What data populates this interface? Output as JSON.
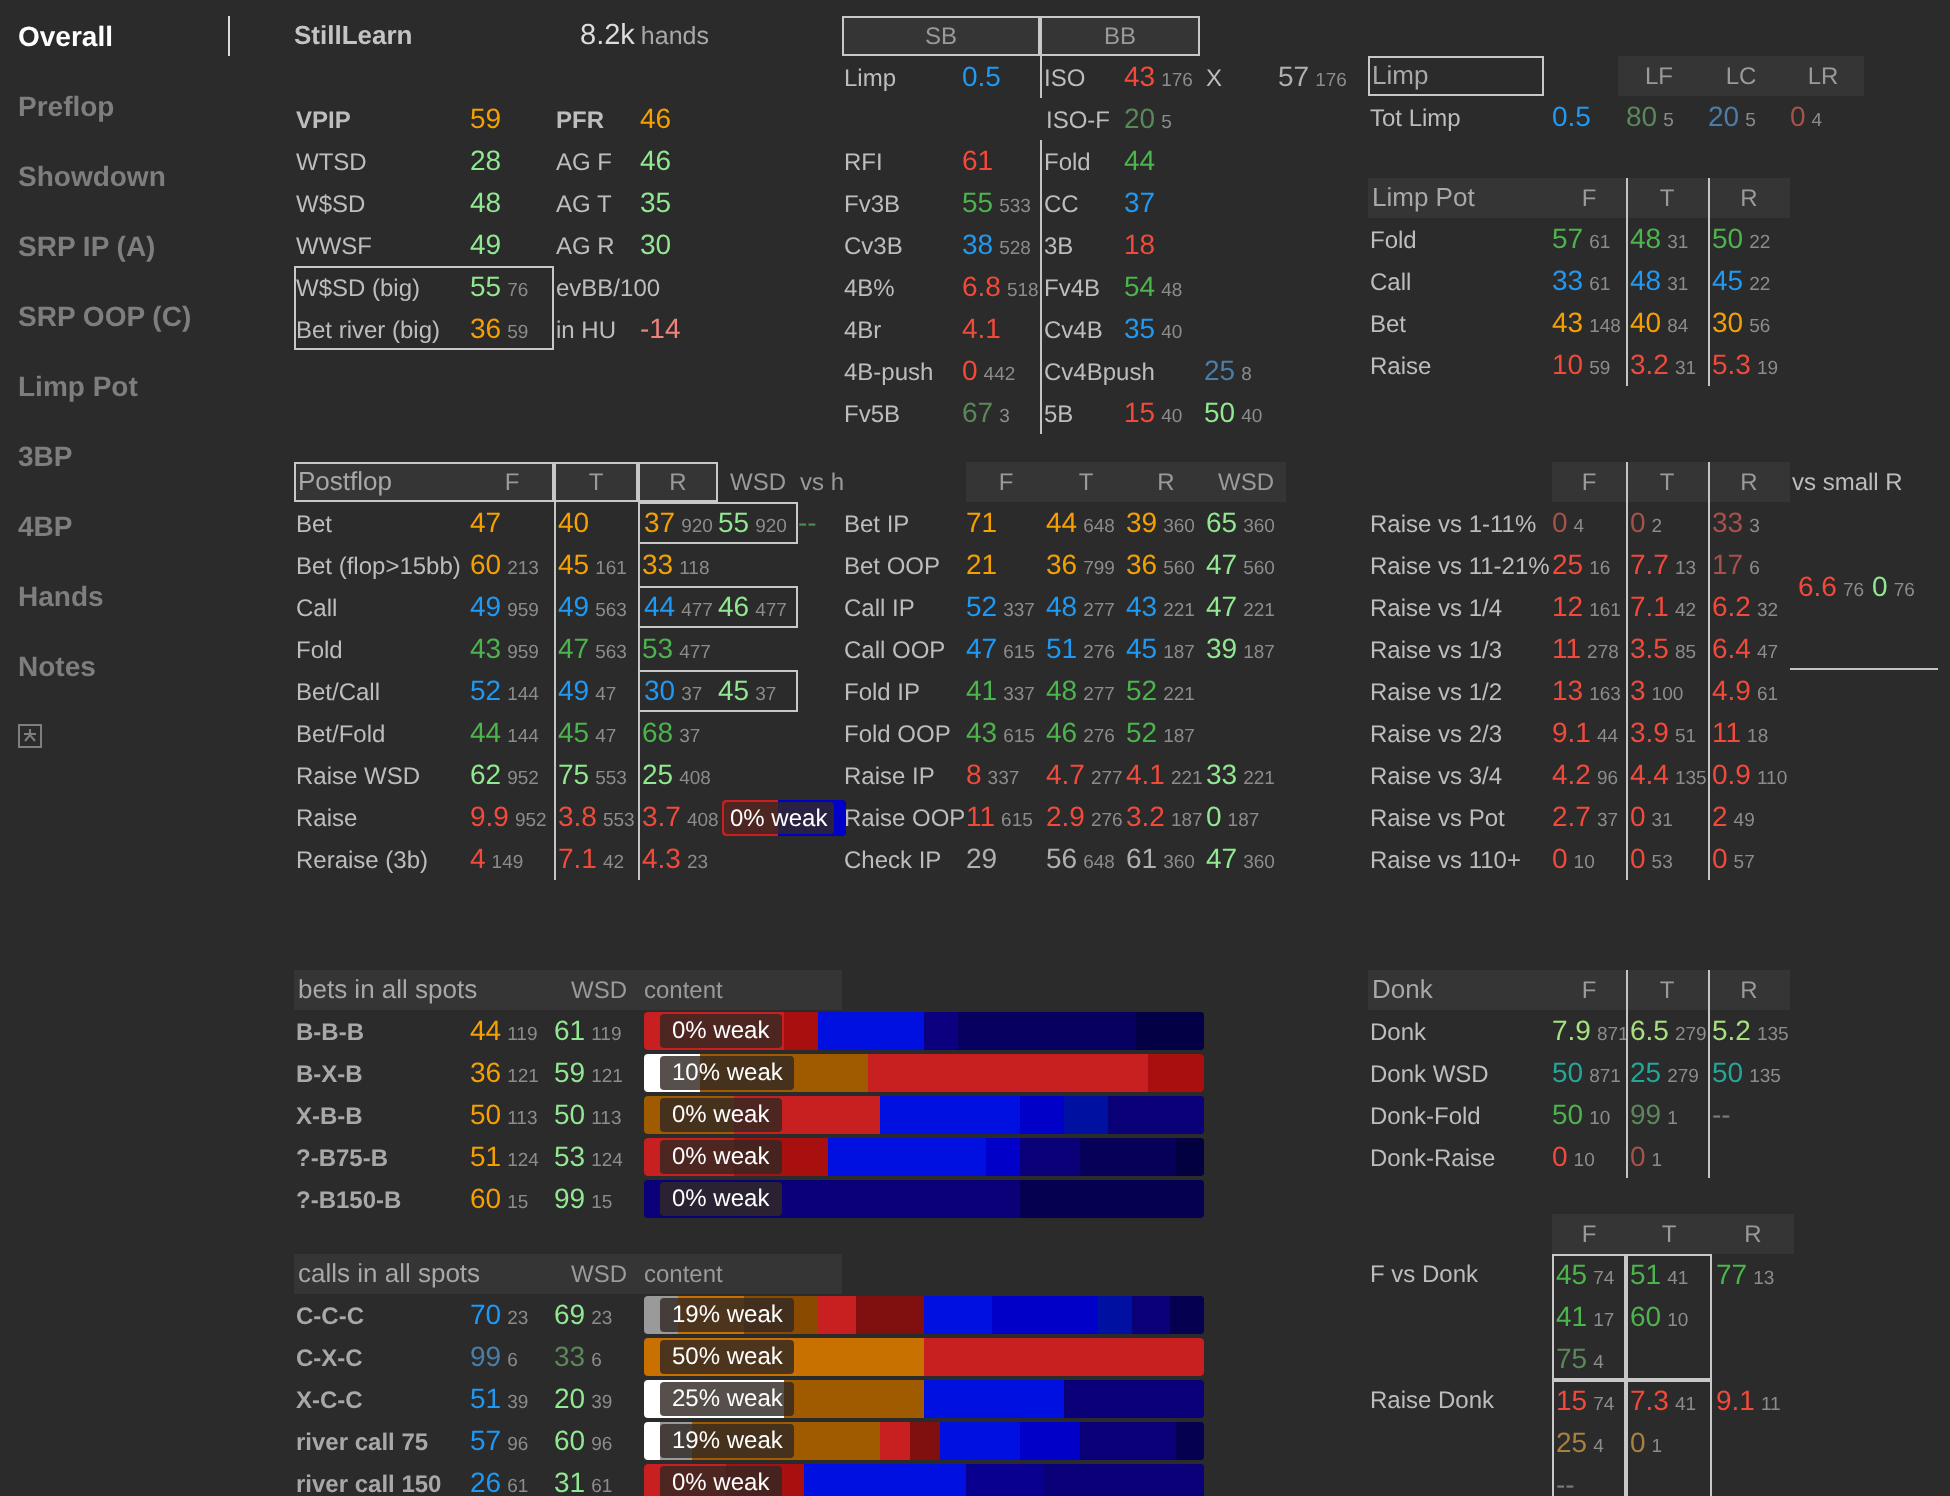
{
  "sidebar": {
    "items": [
      {
        "kind": "text",
        "label": "Overall",
        "selected": true
      },
      {
        "kind": "text",
        "label": "Preflop",
        "selected": false
      },
      {
        "kind": "text",
        "label": "Showdown",
        "selected": false
      },
      {
        "kind": "text",
        "label": "SRP IP (A)",
        "selected": false
      },
      {
        "kind": "text",
        "label": "SRP OOP (C)",
        "selected": false
      },
      {
        "kind": "text",
        "label": "Limp Pot",
        "selected": false
      },
      {
        "kind": "text",
        "label": "3BP",
        "selected": false
      },
      {
        "kind": "text",
        "label": "4BP",
        "selected": false
      },
      {
        "kind": "text",
        "label": "Hands",
        "selected": false
      },
      {
        "kind": "text",
        "label": "Notes",
        "selected": false
      },
      {
        "kind": "icon",
        "selected": false
      }
    ]
  },
  "player": {
    "name": "StillLearn",
    "hands": "8.2k",
    "hands_label": "hands"
  },
  "summary": {
    "rows": [
      {
        "emphasis": true,
        "boxed": false,
        "label": "VPIP",
        "stat": {
          "value": "59",
          "color": "#f5a000"
        },
        "label_2": "PFR",
        "stat_2": {
          "value": "46",
          "color": "#f5a000"
        }
      },
      {
        "emphasis": false,
        "boxed": false,
        "label": "WTSD",
        "stat": {
          "value": "28",
          "color": "#90e890"
        },
        "label_2": "AG F",
        "stat_2": {
          "value": "46",
          "color": "#90e890"
        }
      },
      {
        "emphasis": false,
        "boxed": false,
        "label": "W$SD",
        "stat": {
          "value": "48",
          "color": "#90e890"
        },
        "label_2": "AG T",
        "stat_2": {
          "value": "35",
          "color": "#90e890"
        }
      },
      {
        "emphasis": false,
        "boxed": false,
        "label": "WWSF",
        "stat": {
          "value": "49",
          "color": "#90e890"
        },
        "label_2": "AG R",
        "stat_2": {
          "value": "30",
          "color": "#90e890"
        }
      },
      {
        "emphasis": false,
        "boxed": true,
        "label": "W$SD (big)",
        "stat": {
          "value": "55",
          "count": "76",
          "color": "#90e890"
        },
        "label_2": "evBB/100"
      },
      {
        "emphasis": false,
        "boxed": true,
        "label": "Bet river (big)",
        "stat": {
          "value": "36",
          "count": "59",
          "color": "#f5a000"
        },
        "label_2": "in HU",
        "stat_2": {
          "value": "-14",
          "color": "#f0847a"
        }
      }
    ]
  },
  "postflop": {
    "title": "Postflop",
    "columns": [
      "F",
      "T",
      "R",
      "WSD",
      "vs h"
    ],
    "rows": [
      {
        "label": "Bet",
        "boxed": true,
        "cells": [
          {
            "value": "47",
            "color": "#f5a000"
          },
          {
            "value": "40",
            "color": "#f5a000"
          },
          {
            "value": "37",
            "count": "920",
            "color": "#f5a000"
          },
          {
            "value": "55",
            "count": "920",
            "color": "#90e890"
          },
          {
            "value": "--",
            "color": "#4f8a4f"
          }
        ]
      },
      {
        "label": "Bet (flop>15bb)",
        "boxed": false,
        "cells": [
          {
            "value": "60",
            "count": "213",
            "color": "#f5a000"
          },
          {
            "value": "45",
            "count": "161",
            "color": "#f5a000"
          },
          {
            "value": "33",
            "count": "118",
            "color": "#f5a000"
          },
          null,
          null
        ]
      },
      {
        "label": "Call",
        "boxed": true,
        "cells": [
          {
            "value": "49",
            "count": "959",
            "color": "#1e9af5"
          },
          {
            "value": "49",
            "count": "563",
            "color": "#1e9af5"
          },
          {
            "value": "44",
            "count": "477",
            "color": "#1e9af5"
          },
          {
            "value": "46",
            "count": "477",
            "color": "#90e890"
          },
          null
        ]
      },
      {
        "label": "Fold",
        "boxed": false,
        "cells": [
          {
            "value": "43",
            "count": "959",
            "color": "#4cb44c"
          },
          {
            "value": "47",
            "count": "563",
            "color": "#4cb44c"
          },
          {
            "value": "53",
            "count": "477",
            "color": "#4cb44c"
          },
          null,
          null
        ]
      },
      {
        "label": "Bet/Call",
        "boxed": true,
        "cells": [
          {
            "value": "52",
            "count": "144",
            "color": "#1e9af5"
          },
          {
            "value": "49",
            "count": "47",
            "color": "#1e9af5"
          },
          {
            "value": "30",
            "count": "37",
            "color": "#1e9af5"
          },
          {
            "value": "45",
            "count": "37",
            "color": "#90e890"
          },
          null
        ]
      },
      {
        "label": "Bet/Fold",
        "boxed": false,
        "cells": [
          {
            "value": "44",
            "count": "144",
            "color": "#4cb44c"
          },
          {
            "value": "45",
            "count": "47",
            "color": "#4cb44c"
          },
          {
            "value": "68",
            "count": "37",
            "color": "#4cb44c"
          },
          null,
          null
        ]
      },
      {
        "label": "Raise WSD",
        "boxed": false,
        "cells": [
          {
            "value": "62",
            "count": "952",
            "color": "#90e890"
          },
          {
            "value": "75",
            "count": "553",
            "color": "#90e890"
          },
          {
            "value": "25",
            "count": "408",
            "color": "#90e890"
          },
          null,
          null
        ]
      },
      {
        "label": "Raise",
        "boxed": false,
        "cells": [
          {
            "value": "9.9",
            "count": "952",
            "color": "#f24a3a"
          },
          {
            "value": "3.8",
            "count": "553",
            "color": "#f24a3a"
          },
          {
            "value": "3.7",
            "count": "408",
            "color": "#f24a3a"
          },
          null,
          null
        ],
        "bar": {
          "label": "0% weak",
          "segments": [
            {
              "color": "#c82020"
            },
            {
              "color": "#0000c8"
            }
          ]
        }
      },
      {
        "label": "Reraise (3b)",
        "boxed": false,
        "cells": [
          {
            "value": "4",
            "count": "149",
            "color": "#f24a3a"
          },
          {
            "value": "7.1",
            "count": "42",
            "color": "#f24a3a"
          },
          {
            "value": "4.3",
            "count": "23",
            "color": "#f24a3a"
          },
          null,
          null
        ]
      }
    ]
  },
  "preflop": {
    "columns": [
      "SB",
      "BB"
    ],
    "rows": [
      {
        "sb_label": "Limp",
        "sb_stat": {
          "value": "0.5",
          "color": "#1e9af5"
        },
        "bb_label": "ISO",
        "bb_stat": {
          "value": "43",
          "count": "176",
          "color": "#f24a3a"
        },
        "extra": [
          {
            "kind": "label",
            "text": "X"
          },
          {
            "kind": "stat",
            "value": "57",
            "count": "176",
            "color": "#b0b0b0"
          }
        ]
      },
      {
        "bb_label": "ISO-F",
        "bb_stat": {
          "value": "20",
          "count": "5",
          "color": "#5a885a"
        }
      },
      {
        "sb_label": "RFI",
        "sb_stat": {
          "value": "61",
          "color": "#f24a3a"
        },
        "bb_label": "Fold",
        "bb_stat": {
          "value": "44",
          "color": "#4cb44c"
        }
      },
      {
        "sb_label": "Fv3B",
        "sb_stat": {
          "value": "55",
          "count": "533",
          "color": "#4cb44c"
        },
        "bb_label": "CC",
        "bb_stat": {
          "value": "37",
          "color": "#1e9af5"
        }
      },
      {
        "sb_label": "Cv3B",
        "sb_stat": {
          "value": "38",
          "count": "528",
          "color": "#1e9af5"
        },
        "bb_label": "3B",
        "bb_stat": {
          "value": "18",
          "color": "#f24a3a"
        }
      },
      {
        "sb_label": "4B%",
        "sb_stat": {
          "value": "6.8",
          "count": "518",
          "color": "#f24a3a"
        },
        "bb_label": "Fv4B",
        "bb_stat": {
          "value": "54",
          "count": "48",
          "color": "#4cb44c"
        }
      },
      {
        "sb_label": "4Br",
        "sb_stat": {
          "value": "4.1",
          "color": "#f24a3a"
        },
        "bb_label": "Cv4B",
        "bb_stat": {
          "value": "35",
          "count": "40",
          "color": "#1e9af5"
        }
      },
      {
        "sb_label": "4B-push",
        "sb_stat": {
          "value": "0",
          "count": "442",
          "color": "#f24a3a"
        },
        "bb_label": "Cv4Bpush",
        "extra": [
          {
            "kind": "stat",
            "value": "25",
            "count": "8",
            "color": "#4a7ea8"
          }
        ]
      },
      {
        "sb_label": "Fv5B",
        "sb_stat": {
          "value": "67",
          "count": "3",
          "color": "#5a885a"
        },
        "bb_label": "5B",
        "bb_stat": {
          "value": "15",
          "count": "40",
          "color": "#f24a3a"
        },
        "extra": [
          {
            "kind": "stat",
            "value": "50",
            "count": "40",
            "color": "#90e890"
          }
        ]
      }
    ]
  },
  "position_stats": {
    "columns": [
      "F",
      "T",
      "R",
      "WSD"
    ],
    "rows": [
      {
        "label": "Bet IP",
        "cells": [
          {
            "value": "71",
            "color": "#f5a000"
          },
          {
            "value": "44",
            "count": "648",
            "color": "#f5a000"
          },
          {
            "value": "39",
            "count": "360",
            "color": "#f5a000"
          },
          {
            "value": "65",
            "count": "360",
            "color": "#90e890"
          }
        ]
      },
      {
        "label": "Bet OOP",
        "cells": [
          {
            "value": "21",
            "color": "#f5a000"
          },
          {
            "value": "36",
            "count": "799",
            "color": "#f5a000"
          },
          {
            "value": "36",
            "count": "560",
            "color": "#f5a000"
          },
          {
            "value": "47",
            "count": "560",
            "color": "#90e890"
          }
        ]
      },
      {
        "label": "Call IP",
        "cells": [
          {
            "value": "52",
            "count": "337",
            "color": "#1e9af5"
          },
          {
            "value": "48",
            "count": "277",
            "color": "#1e9af5"
          },
          {
            "value": "43",
            "count": "221",
            "color": "#1e9af5"
          },
          {
            "value": "47",
            "count": "221",
            "color": "#90e890"
          }
        ]
      },
      {
        "label": "Call OOP",
        "cells": [
          {
            "value": "47",
            "count": "615",
            "color": "#1e9af5"
          },
          {
            "value": "51",
            "count": "276",
            "color": "#1e9af5"
          },
          {
            "value": "45",
            "count": "187",
            "color": "#1e9af5"
          },
          {
            "value": "39",
            "count": "187",
            "color": "#90e890"
          }
        ]
      },
      {
        "label": "Fold IP",
        "cells": [
          {
            "value": "41",
            "count": "337",
            "color": "#4cb44c"
          },
          {
            "value": "48",
            "count": "277",
            "color": "#4cb44c"
          },
          {
            "value": "52",
            "count": "221",
            "color": "#4cb44c"
          },
          null
        ]
      },
      {
        "label": "Fold OOP",
        "cells": [
          {
            "value": "43",
            "count": "615",
            "color": "#4cb44c"
          },
          {
            "value": "46",
            "count": "276",
            "color": "#4cb44c"
          },
          {
            "value": "52",
            "count": "187",
            "color": "#4cb44c"
          },
          null
        ]
      },
      {
        "label": "Raise IP",
        "cells": [
          {
            "value": "8",
            "count": "337",
            "color": "#f24a3a"
          },
          {
            "value": "4.7",
            "count": "277",
            "color": "#f24a3a"
          },
          {
            "value": "4.1",
            "count": "221",
            "color": "#f24a3a"
          },
          {
            "value": "33",
            "count": "221",
            "color": "#90e890"
          }
        ]
      },
      {
        "label": "Raise OOP",
        "cells": [
          {
            "value": "11",
            "count": "615",
            "color": "#f24a3a"
          },
          {
            "value": "2.9",
            "count": "276",
            "color": "#f24a3a"
          },
          {
            "value": "3.2",
            "count": "187",
            "color": "#f24a3a"
          },
          {
            "value": "0",
            "count": "187",
            "color": "#90e890"
          }
        ]
      },
      {
        "label": "Check IP",
        "cells": [
          {
            "value": "29",
            "color": "#b0b0b0"
          },
          {
            "value": "56",
            "count": "648",
            "color": "#b0b0b0"
          },
          {
            "value": "61",
            "count": "360",
            "color": "#b0b0b0"
          },
          {
            "value": "47",
            "count": "360",
            "color": "#90e890"
          }
        ]
      }
    ]
  },
  "limp": {
    "title": "Limp",
    "columns": [
      "LF",
      "LC",
      "LR"
    ],
    "rows": [
      {
        "label": "Tot Limp",
        "total": {
          "value": "0.5",
          "color": "#1e9af5"
        },
        "cells": [
          {
            "value": "80",
            "count": "5",
            "color": "#5a885a"
          },
          {
            "value": "20",
            "count": "5",
            "color": "#4a7ea8"
          },
          {
            "value": "0",
            "count": "4",
            "color": "#a8504a"
          }
        ]
      }
    ]
  },
  "limp_pot": {
    "title": "Limp Pot",
    "columns": [
      "F",
      "T",
      "R"
    ],
    "rows": [
      {
        "label": "Fold",
        "cells": [
          {
            "value": "57",
            "count": "61",
            "color": "#4cb44c"
          },
          {
            "value": "48",
            "count": "31",
            "color": "#4cb44c"
          },
          {
            "value": "50",
            "count": "22",
            "color": "#4cb44c"
          }
        ]
      },
      {
        "label": "Call",
        "cells": [
          {
            "value": "33",
            "count": "61",
            "color": "#1e9af5"
          },
          {
            "value": "48",
            "count": "31",
            "color": "#1e9af5"
          },
          {
            "value": "45",
            "count": "22",
            "color": "#1e9af5"
          }
        ]
      },
      {
        "label": "Bet",
        "cells": [
          {
            "value": "43",
            "count": "148",
            "color": "#f5a000"
          },
          {
            "value": "40",
            "count": "84",
            "color": "#f5a000"
          },
          {
            "value": "30",
            "count": "56",
            "color": "#f5a000"
          }
        ]
      },
      {
        "label": "Raise",
        "cells": [
          {
            "value": "10",
            "count": "59",
            "color": "#f24a3a"
          },
          {
            "value": "3.2",
            "count": "31",
            "color": "#f24a3a"
          },
          {
            "value": "5.3",
            "count": "19",
            "color": "#f24a3a"
          }
        ]
      }
    ]
  },
  "raise_vs": {
    "columns": [
      "F",
      "T",
      "R"
    ],
    "side_label": "vs small R",
    "side_cells": [
      {
        "value": "6.6",
        "count": "76",
        "color": "#f24a3a"
      },
      {
        "value": "0",
        "count": "76",
        "color": "#90e890"
      }
    ],
    "rows": [
      {
        "label": "Raise vs 1-11%",
        "cells": [
          {
            "value": "0",
            "count": "4",
            "color": "#a8504a"
          },
          {
            "value": "0",
            "count": "2",
            "color": "#a8504a"
          },
          {
            "value": "33",
            "count": "3",
            "color": "#a8504a"
          }
        ]
      },
      {
        "label": "Raise vs 11-21%",
        "cells": [
          {
            "value": "25",
            "count": "16",
            "color": "#f24a3a"
          },
          {
            "value": "7.7",
            "count": "13",
            "color": "#f24a3a"
          },
          {
            "value": "17",
            "count": "6",
            "color": "#a8504a"
          }
        ]
      },
      {
        "label": "Raise vs 1/4",
        "cells": [
          {
            "value": "12",
            "count": "161",
            "color": "#f24a3a"
          },
          {
            "value": "7.1",
            "count": "42",
            "color": "#f24a3a"
          },
          {
            "value": "6.2",
            "count": "32",
            "color": "#f24a3a"
          }
        ]
      },
      {
        "label": "Raise vs 1/3",
        "cells": [
          {
            "value": "11",
            "count": "278",
            "color": "#f24a3a"
          },
          {
            "value": "3.5",
            "count": "85",
            "color": "#f24a3a"
          },
          {
            "value": "6.4",
            "count": "47",
            "color": "#f24a3a"
          }
        ]
      },
      {
        "label": "Raise vs 1/2",
        "cells": [
          {
            "value": "13",
            "count": "163",
            "color": "#f24a3a"
          },
          {
            "value": "3",
            "count": "100",
            "color": "#f24a3a"
          },
          {
            "value": "4.9",
            "count": "61",
            "color": "#f24a3a"
          }
        ]
      },
      {
        "label": "Raise vs 2/3",
        "cells": [
          {
            "value": "9.1",
            "count": "44",
            "color": "#f24a3a"
          },
          {
            "value": "3.9",
            "count": "51",
            "color": "#f24a3a"
          },
          {
            "value": "11",
            "count": "18",
            "color": "#f24a3a"
          }
        ]
      },
      {
        "label": "Raise vs 3/4",
        "cells": [
          {
            "value": "4.2",
            "count": "96",
            "color": "#f24a3a"
          },
          {
            "value": "4.4",
            "count": "135",
            "color": "#f24a3a"
          },
          {
            "value": "0.9",
            "count": "110",
            "color": "#f24a3a"
          }
        ]
      },
      {
        "label": "Raise vs Pot",
        "cells": [
          {
            "value": "2.7",
            "count": "37",
            "color": "#f24a3a"
          },
          {
            "value": "0",
            "count": "31",
            "color": "#f24a3a"
          },
          {
            "value": "2",
            "count": "49",
            "color": "#f24a3a"
          }
        ]
      },
      {
        "label": "Raise vs 110+",
        "cells": [
          {
            "value": "0",
            "count": "10",
            "color": "#f24a3a"
          },
          {
            "value": "0",
            "count": "53",
            "color": "#f24a3a"
          },
          {
            "value": "0",
            "count": "57",
            "color": "#f24a3a"
          }
        ]
      }
    ]
  },
  "bets": {
    "title": "bets in all spots",
    "columns": [
      "WSD",
      "content"
    ],
    "rows": [
      {
        "label": "B-B-B",
        "stat": {
          "value": "44",
          "count": "119",
          "color": "#f5a000"
        },
        "wsd": {
          "value": "61",
          "count": "119",
          "color": "#90e890"
        },
        "bar": {
          "label": "0% weak",
          "segments": [
            {
              "color": "#c82020"
            },
            {
              "color": "#a81010"
            },
            {
              "color": "#0010e0"
            },
            {
              "color": "#0a0080"
            },
            {
              "color": "#060060"
            },
            {
              "color": "#030045"
            }
          ]
        }
      },
      {
        "label": "B-X-B",
        "stat": {
          "value": "36",
          "count": "121",
          "color": "#f5a000"
        },
        "wsd": {
          "value": "59",
          "count": "121",
          "color": "#90e890"
        },
        "bar": {
          "label": "10% weak",
          "segments": [
            {
              "color": "#ffffff"
            },
            {
              "color": "#a05a00"
            },
            {
              "color": "#c82020"
            },
            {
              "color": "#a81010"
            }
          ]
        }
      },
      {
        "label": "X-B-B",
        "stat": {
          "value": "50",
          "count": "113",
          "color": "#f5a000"
        },
        "wsd": {
          "value": "50",
          "count": "113",
          "color": "#90e890"
        },
        "bar": {
          "label": "0% weak",
          "segments": [
            {
              "color": "#a05a00"
            },
            {
              "color": "#c82020"
            },
            {
              "color": "#0010e0"
            },
            {
              "color": "#0000c8"
            },
            {
              "color": "#0010a0"
            },
            {
              "color": "#0a0078"
            }
          ]
        }
      },
      {
        "label": "?-B75-B",
        "stat": {
          "value": "51",
          "count": "124",
          "color": "#f5a000"
        },
        "wsd": {
          "value": "53",
          "count": "124",
          "color": "#90e890"
        },
        "bar": {
          "label": "0% weak",
          "segments": [
            {
              "color": "#c82020"
            },
            {
              "color": "#a81010"
            },
            {
              "color": "#0010e0"
            },
            {
              "color": "#0000c8"
            },
            {
              "color": "#0a0078"
            },
            {
              "color": "#060058"
            },
            {
              "color": "#030040"
            }
          ]
        }
      },
      {
        "label": "?-B150-B",
        "stat": {
          "value": "60",
          "count": "15",
          "color": "#f5a000"
        },
        "wsd": {
          "value": "99",
          "count": "15",
          "color": "#90e890"
        },
        "bar": {
          "label": "0% weak",
          "segments": [
            {
              "color": "#0a0078"
            },
            {
              "color": "#050050"
            }
          ]
        }
      }
    ]
  },
  "calls": {
    "title": "calls in all spots",
    "columns": [
      "WSD",
      "content"
    ],
    "rows": [
      {
        "label": "C-C-C",
        "stat": {
          "value": "70",
          "count": "23",
          "color": "#1e9af5"
        },
        "wsd": {
          "value": "69",
          "count": "23",
          "color": "#90e890"
        },
        "bar": {
          "label": "19% weak",
          "segments": [
            {
              "color": "#9a9a9a"
            },
            {
              "color": "#c87000"
            },
            {
              "color": "#8a4a00"
            },
            {
              "color": "#c82020"
            },
            {
              "color": "#801010"
            },
            {
              "color": "#0010e0"
            },
            {
              "color": "#0000c8"
            },
            {
              "color": "#0010a0"
            },
            {
              "color": "#0a0078"
            },
            {
              "color": "#050050"
            }
          ]
        }
      },
      {
        "label": "C-X-C",
        "stat": {
          "value": "99",
          "count": "6",
          "color": "#4a7ea8"
        },
        "wsd": {
          "value": "33",
          "count": "6",
          "color": "#5a885a"
        },
        "bar": {
          "label": "50% weak",
          "segments": [
            {
              "color": "#c87000"
            },
            {
              "color": "#c82020"
            }
          ]
        }
      },
      {
        "label": "X-C-C",
        "stat": {
          "value": "51",
          "count": "39",
          "color": "#1e9af5"
        },
        "wsd": {
          "value": "20",
          "count": "39",
          "color": "#90e890"
        },
        "bar": {
          "label": "25% weak",
          "segments": [
            {
              "color": "#ffffff"
            },
            {
              "color": "#a05a00"
            },
            {
              "color": "#0010e0"
            },
            {
              "color": "#0a0078"
            }
          ]
        }
      },
      {
        "label": "river call 75",
        "stat": {
          "value": "57",
          "count": "96",
          "color": "#1e9af5"
        },
        "wsd": {
          "value": "60",
          "count": "96",
          "color": "#90e890"
        },
        "bar": {
          "label": "19% weak",
          "segments": [
            {
              "color": "#ffffff"
            },
            {
              "color": "#9a9a9a"
            },
            {
              "color": "#a05a00"
            },
            {
              "color": "#c82020"
            },
            {
              "color": "#801010"
            },
            {
              "color": "#0010e0"
            },
            {
              "color": "#0000c8"
            },
            {
              "color": "#0a0078"
            },
            {
              "color": "#050050"
            }
          ]
        }
      },
      {
        "label": "river call 150",
        "stat": {
          "value": "26",
          "count": "61",
          "color": "#1e9af5"
        },
        "wsd": {
          "value": "31",
          "count": "61",
          "color": "#90e890"
        },
        "bar": {
          "label": "0% weak",
          "segments": [
            {
              "color": "#c82020"
            },
            {
              "color": "#a81010"
            },
            {
              "color": "#0010e0"
            },
            {
              "color": "#0a0090"
            },
            {
              "color": "#0a0078"
            }
          ]
        }
      }
    ]
  },
  "donk": {
    "title": "Donk",
    "columns": [
      "F",
      "T",
      "R"
    ],
    "rows": [
      {
        "label": "Donk",
        "cells": [
          {
            "value": "7.9",
            "count": "871",
            "color": "#a8e080"
          },
          {
            "value": "6.5",
            "count": "279",
            "color": "#a8e080"
          },
          {
            "value": "5.2",
            "count": "135",
            "color": "#a8e080"
          }
        ]
      },
      {
        "label": "Donk WSD",
        "cells": [
          {
            "value": "50",
            "count": "871",
            "color": "#22a89a"
          },
          {
            "value": "25",
            "count": "279",
            "color": "#22a89a"
          },
          {
            "value": "50",
            "count": "135",
            "color": "#22a89a"
          }
        ]
      },
      {
        "label": "Donk-Fold",
        "cells": [
          {
            "value": "50",
            "count": "10",
            "color": "#4cb44c"
          },
          {
            "value": "99",
            "count": "1",
            "color": "#5a885a"
          },
          {
            "value": "--",
            "color": "#7a7a7a"
          }
        ]
      },
      {
        "label": "Donk-Raise",
        "cells": [
          {
            "value": "0",
            "count": "10",
            "color": "#f24a3a"
          },
          {
            "value": "0",
            "count": "1",
            "color": "#a8504a"
          },
          null
        ]
      }
    ]
  },
  "vs_donk": {
    "columns": [
      "F",
      "T",
      "R"
    ],
    "rows": [
      {
        "label": "F vs Donk",
        "groups": [
          {
            "boxed": true,
            "stats": [
              {
                "value": "45",
                "count": "74",
                "color": "#4cb44c"
              },
              {
                "value": "41",
                "count": "17",
                "color": "#4cb44c"
              },
              {
                "value": "75",
                "count": "4",
                "color": "#5a885a"
              }
            ]
          },
          {
            "boxed": true,
            "stats": [
              {
                "value": "51",
                "count": "41",
                "color": "#4cb44c"
              },
              {
                "value": "60",
                "count": "10",
                "color": "#4cb44c"
              }
            ]
          },
          {
            "boxed": false,
            "stats": [
              {
                "value": "77",
                "count": "13",
                "color": "#4cb44c"
              }
            ]
          }
        ]
      },
      {
        "label": "Raise Donk",
        "groups": [
          {
            "boxed": true,
            "stats": [
              {
                "value": "15",
                "count": "74",
                "color": "#f24a3a"
              },
              {
                "value": "25",
                "count": "4",
                "color": "#a88040"
              },
              {
                "value": "--",
                "color": "#7a7a7a"
              }
            ]
          },
          {
            "boxed": true,
            "stats": [
              {
                "value": "7.3",
                "count": "41",
                "color": "#f24a3a"
              },
              {
                "value": "0",
                "count": "1",
                "color": "#a88040"
              }
            ]
          },
          {
            "boxed": false,
            "stats": [
              {
                "value": "9.1",
                "count": "11",
                "color": "#f24a3a"
              }
            ]
          }
        ]
      }
    ]
  }
}
